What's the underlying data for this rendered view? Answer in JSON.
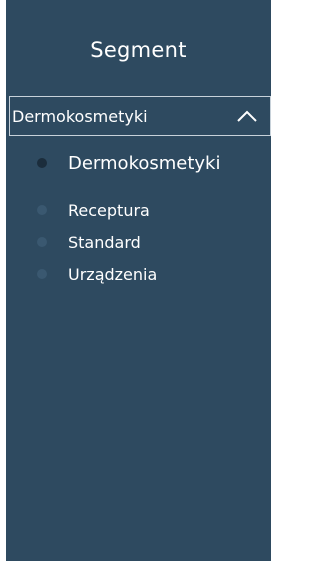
{
  "segment": {
    "title": "Segment",
    "selected_value": "Dermokosmetyki",
    "toggle_icon": "chevron-up-icon",
    "options": [
      {
        "label": "Dermokosmetyki",
        "selected": true
      },
      {
        "label": "Receptura",
        "selected": false
      },
      {
        "label": "Standard",
        "selected": false
      },
      {
        "label": "Urządzenia",
        "selected": false
      }
    ]
  },
  "colors": {
    "panel_background": "#2e4a60",
    "text": "#ffffff",
    "border": "#c8d2da"
  }
}
